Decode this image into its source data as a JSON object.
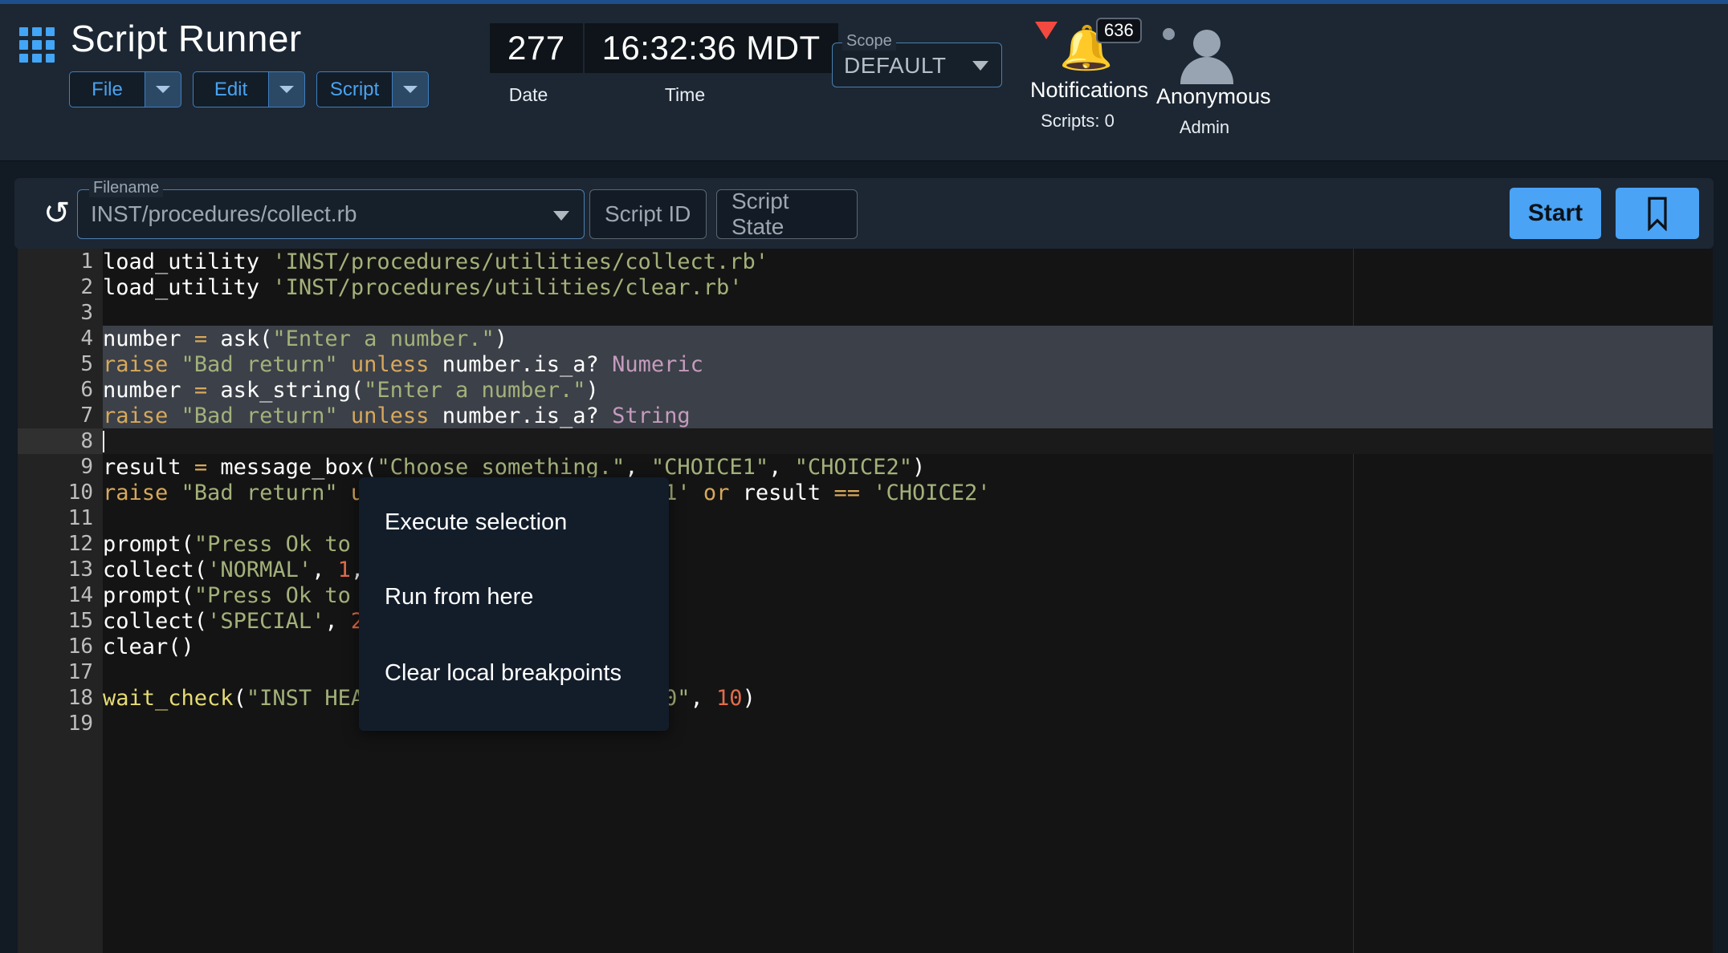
{
  "app": {
    "title": "Script Runner",
    "grid_icon": "apps-grid-icon"
  },
  "menus": [
    {
      "label": "File",
      "dropdown_icon": "chevron-down-icon"
    },
    {
      "label": "Edit",
      "dropdown_icon": "chevron-down-icon"
    },
    {
      "label": "Script",
      "dropdown_icon": "chevron-down-icon"
    }
  ],
  "datetime": {
    "date_value": "277",
    "time_value": "16:32:36 MDT",
    "date_label": "Date",
    "time_label": "Time"
  },
  "scope": {
    "legend": "Scope",
    "value": "DEFAULT",
    "caret_icon": "chevron-down-icon"
  },
  "notifications": {
    "label": "Notifications",
    "count": "636",
    "sub": "Scripts: 0",
    "bell_icon": "bell-icon",
    "alert_icon": "alert-triangle-icon"
  },
  "user": {
    "name": "Anonymous",
    "role": "Admin",
    "avatar_icon": "person-icon"
  },
  "toolbar": {
    "refresh_icon": "refresh-icon",
    "filename_legend": "Filename",
    "filename_value": "INST/procedures/collect.rb",
    "filename_caret_icon": "chevron-down-icon",
    "script_id_placeholder": "Script ID",
    "script_state_placeholder": "Script State",
    "start_label": "Start",
    "bookmark_icon": "bookmark-icon"
  },
  "context_menu": {
    "items": [
      "Execute selection",
      "Run from here",
      "Clear local breakpoints"
    ]
  },
  "editor": {
    "lines": [
      {
        "n": "1",
        "state": "normal"
      },
      {
        "n": "2",
        "state": "normal"
      },
      {
        "n": "3",
        "state": "normal"
      },
      {
        "n": "4",
        "state": "selected"
      },
      {
        "n": "5",
        "state": "selected"
      },
      {
        "n": "6",
        "state": "selected"
      },
      {
        "n": "7",
        "state": "selected"
      },
      {
        "n": "8",
        "state": "active"
      },
      {
        "n": "9",
        "state": "normal"
      },
      {
        "n": "10",
        "state": "normal"
      },
      {
        "n": "11",
        "state": "normal"
      },
      {
        "n": "12",
        "state": "normal"
      },
      {
        "n": "13",
        "state": "normal"
      },
      {
        "n": "14",
        "state": "normal"
      },
      {
        "n": "15",
        "state": "normal"
      },
      {
        "n": "16",
        "state": "normal"
      },
      {
        "n": "17",
        "state": "normal"
      },
      {
        "n": "18",
        "state": "normal"
      },
      {
        "n": "19",
        "state": "normal"
      }
    ],
    "code_text": [
      "load_utility 'INST/procedures/utilities/collect.rb'",
      "load_utility 'INST/procedures/utilities/clear.rb'",
      "",
      "number = ask(\"Enter a number.\")",
      "raise \"Bad return\" unless number.is_a? Numeric",
      "number = ask_string(\"Enter a number.\")",
      "raise \"Bad return\" unless number.is_a? String",
      "",
      "result = message_box(\"Choose something.\", \"CHOICE1\", \"CHOICE2\")",
      "raise \"Bad return\" unless result == 'CHOICE1' or result == 'CHOICE2'",
      "",
      "prompt(\"Press Ok to start NORMAL Collect\")",
      "collect('NORMAL', 1, false)",
      "prompt(\"Press Ok to start SPECIAL Collect\")",
      "collect('SPECIAL', 2, true)",
      "clear()",
      "",
      "wait_check(\"INST HEALTH_STATUS COLLECTS == 0\", 10)",
      ""
    ]
  },
  "colors": {
    "accent_blue": "#4aa3f5",
    "appbar_bg": "#1c2733",
    "editor_bg": "#141414",
    "gutter_bg": "#232323",
    "selection_bg": "#3c4048",
    "menu_bg": "#131d2a",
    "notification_red": "#f4493f",
    "string_green": "#a3b17a",
    "keyword_orange": "#d7a85c",
    "number_red": "#e06c4b",
    "constant_purple": "#c49bbe"
  }
}
